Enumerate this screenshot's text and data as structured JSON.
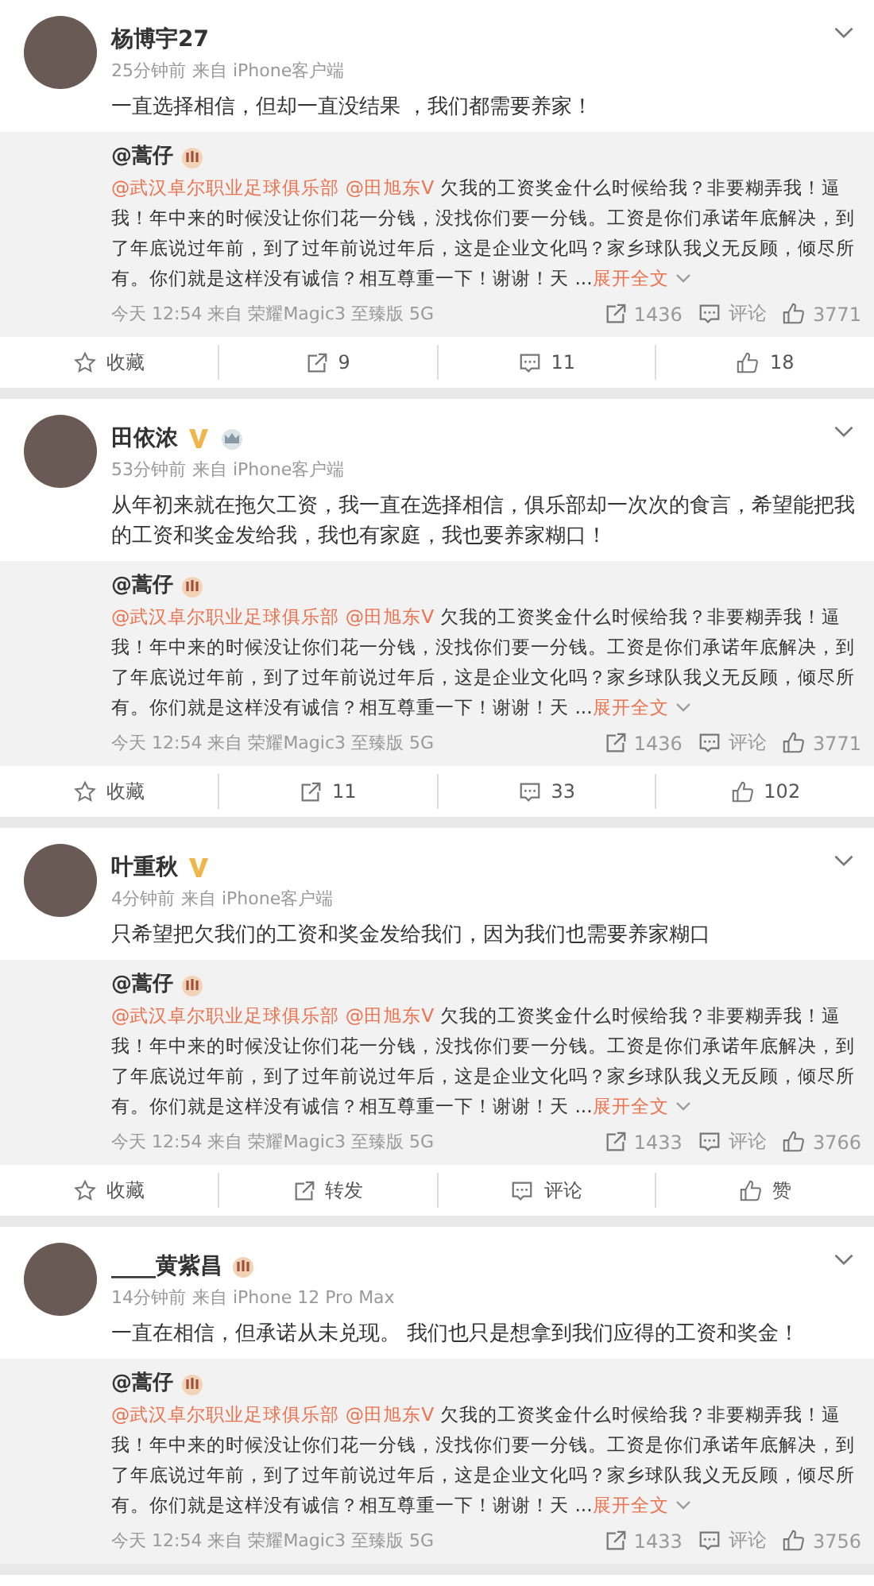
{
  "posts": [
    {
      "name": "杨博宇27",
      "verified": false,
      "crown": false,
      "medal": false,
      "time": "25分钟前",
      "source": "来自 iPhone客户端",
      "text": "一直选择相信，但却一直没结果 ，我们都需要养家！",
      "quote": {
        "author": "@蒿仔",
        "mentions": [
          "@武汉卓尔职业足球俱乐部",
          "@田旭东V"
        ],
        "text": "欠我的工资奖金什么时候给我？非要糊弄我！逼我！年中来的时候没让你们花一分钱，没找你们要一分钱。工资是你们承诺年底解决，到了年底说过年前，到了过年前说过年后，这是企业文化吗？家乡球队我义无反顾，倾尽所有。你们就是这样没有诚信？相互尊重一下！谢谢！天 ...",
        "expand": "展开全文",
        "meta": "今天 12:54 来自 荣耀Magic3 至臻版 5G",
        "reposts": "1436",
        "comments": "评论",
        "likes": "3771"
      },
      "actions": [
        {
          "kind": "favorite",
          "label": "收藏"
        },
        {
          "kind": "repost",
          "label": "9"
        },
        {
          "kind": "comment",
          "label": "11"
        },
        {
          "kind": "like",
          "label": "18"
        }
      ]
    },
    {
      "name": "田依浓",
      "verified": true,
      "crown": true,
      "medal": false,
      "time": "53分钟前",
      "source": "来自 iPhone客户端",
      "text": "从年初来就在拖欠工资，我一直在选择相信，俱乐部却一次次的食言，希望能把我的工资和奖金发给我，我也有家庭，我也要养家糊口！",
      "quote": {
        "author": "@蒿仔",
        "mentions": [
          "@武汉卓尔职业足球俱乐部",
          "@田旭东V"
        ],
        "text": "欠我的工资奖金什么时候给我？非要糊弄我！逼我！年中来的时候没让你们花一分钱，没找你们要一分钱。工资是你们承诺年底解决，到了年底说过年前，到了过年前说过年后，这是企业文化吗？家乡球队我义无反顾，倾尽所有。你们就是这样没有诚信？相互尊重一下！谢谢！天 ...",
        "expand": "展开全文",
        "meta": "今天 12:54 来自 荣耀Magic3 至臻版 5G",
        "reposts": "1436",
        "comments": "评论",
        "likes": "3771"
      },
      "actions": [
        {
          "kind": "favorite",
          "label": "收藏"
        },
        {
          "kind": "repost",
          "label": "11"
        },
        {
          "kind": "comment",
          "label": "33"
        },
        {
          "kind": "like",
          "label": "102"
        }
      ]
    },
    {
      "name": "叶重秋",
      "verified": true,
      "crown": false,
      "medal": false,
      "time": "4分钟前",
      "source": "来自 iPhone客户端",
      "text": "只希望把欠我们的工资和奖金发给我们，因为我们也需要养家糊口",
      "quote": {
        "author": "@蒿仔",
        "mentions": [
          "@武汉卓尔职业足球俱乐部",
          "@田旭东V"
        ],
        "text": "欠我的工资奖金什么时候给我？非要糊弄我！逼我！年中来的时候没让你们花一分钱，没找你们要一分钱。工资是你们承诺年底解决，到了年底说过年前，到了过年前说过年后，这是企业文化吗？家乡球队我义无反顾，倾尽所有。你们就是这样没有诚信？相互尊重一下！谢谢！天 ...",
        "expand": "展开全文",
        "meta": "今天 12:54 来自 荣耀Magic3 至臻版 5G",
        "reposts": "1433",
        "comments": "评论",
        "likes": "3766"
      },
      "actions": [
        {
          "kind": "favorite",
          "label": "收藏"
        },
        {
          "kind": "repost",
          "label": "转发"
        },
        {
          "kind": "comment",
          "label": "评论"
        },
        {
          "kind": "like",
          "label": "赞"
        }
      ]
    },
    {
      "name": "____黄紫昌",
      "verified": false,
      "crown": false,
      "medal": true,
      "time": "14分钟前",
      "source": "来自 iPhone 12 Pro Max",
      "text": "一直在相信，但承诺从未兑现。 我们也只是想拿到我们应得的工资和奖金！",
      "quote": {
        "author": "@蒿仔",
        "mentions": [
          "@武汉卓尔职业足球俱乐部",
          "@田旭东V"
        ],
        "text": "欠我的工资奖金什么时候给我？非要糊弄我！逼我！年中来的时候没让你们花一分钱，没找你们要一分钱。工资是你们承诺年底解决，到了年底说过年前，到了过年前说过年后，这是企业文化吗？家乡球队我义无反顾，倾尽所有。你们就是这样没有诚信？相互尊重一下！谢谢！天 ...",
        "expand": "展开全文",
        "meta": "今天 12:54 来自 荣耀Magic3 至臻版 5G",
        "reposts": "1433",
        "comments": "评论",
        "likes": "3756"
      }
    }
  ]
}
